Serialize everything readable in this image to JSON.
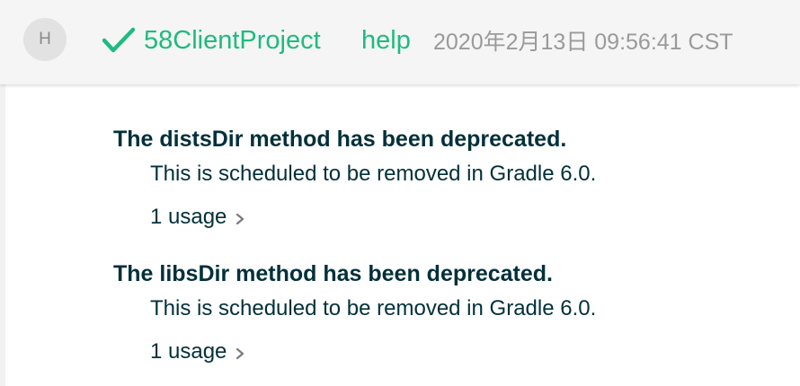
{
  "header": {
    "avatar_initial": "H",
    "status_icon": "check-icon",
    "project_name": "58ClientProject",
    "task_name": "help",
    "timestamp": "2020年2月13日 09:56:41 CST"
  },
  "warnings": [
    {
      "title": "The distsDir method has been deprecated.",
      "detail": "This is scheduled to be removed in Gradle 6.0.",
      "usage_label": "1 usage",
      "expand_icon": "chevron-right-icon"
    },
    {
      "title": "The libsDir method has been deprecated.",
      "detail": "This is scheduled to be removed in Gradle 6.0.",
      "usage_label": "1 usage",
      "expand_icon": "chevron-right-icon"
    }
  ],
  "colors": {
    "accent": "#1fba83",
    "text": "#02303a",
    "muted": "#9a9a9a",
    "header_bg": "#f5f5f5"
  }
}
